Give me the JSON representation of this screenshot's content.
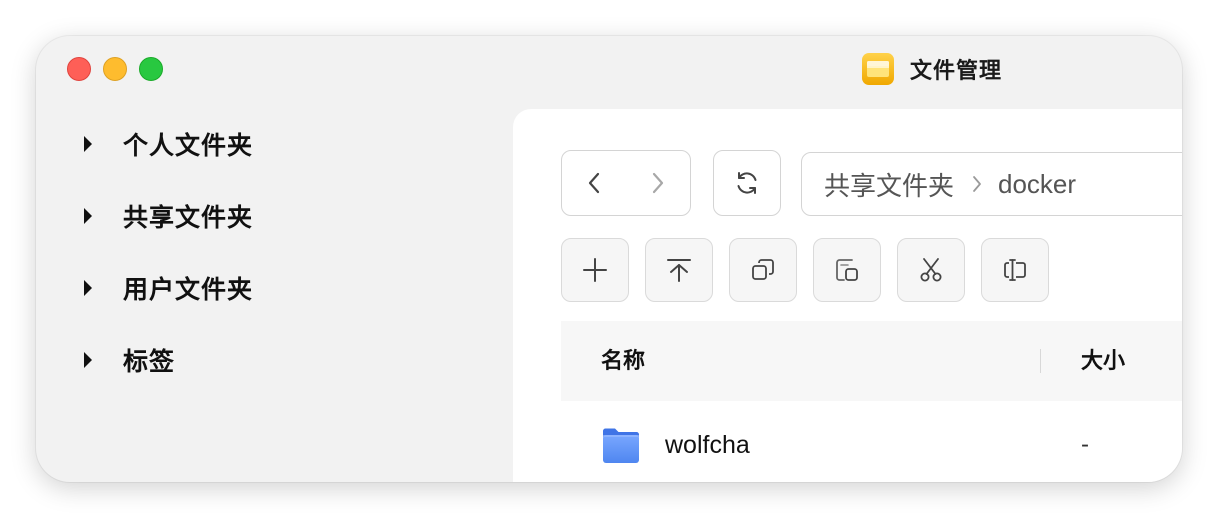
{
  "app": {
    "title": "文件管理",
    "icon": "folder-app-icon"
  },
  "window_controls": [
    "close",
    "minimize",
    "zoom"
  ],
  "sidebar": {
    "items": [
      {
        "label": "个人文件夹",
        "icon": "triangle-right-icon"
      },
      {
        "label": "共享文件夹",
        "icon": "triangle-right-icon"
      },
      {
        "label": "用户文件夹",
        "icon": "triangle-right-icon"
      },
      {
        "label": "标签",
        "icon": "triangle-right-icon"
      }
    ]
  },
  "navigation": {
    "back_icon": "chevron-left-icon",
    "forward_icon": "chevron-right-icon",
    "refresh_icon": "refresh-icon"
  },
  "breadcrumb": {
    "items": [
      "共享文件夹",
      "docker"
    ],
    "separator_icon": "chevron-right-icon"
  },
  "toolbar": {
    "buttons": [
      "plus-icon",
      "upload-icon",
      "copy-icon",
      "paste-icon",
      "cut-icon",
      "rename-icon"
    ]
  },
  "table": {
    "columns": [
      "名称",
      "大小"
    ],
    "rows": [
      {
        "name": "wolfcha",
        "size": "-",
        "icon": "folder-icon"
      }
    ]
  },
  "colors": {
    "close": "#fe5f57",
    "minimize": "#febc2e",
    "zoom": "#28c840",
    "folder": "#5b8ef5",
    "app_icon": "#f5b400"
  }
}
